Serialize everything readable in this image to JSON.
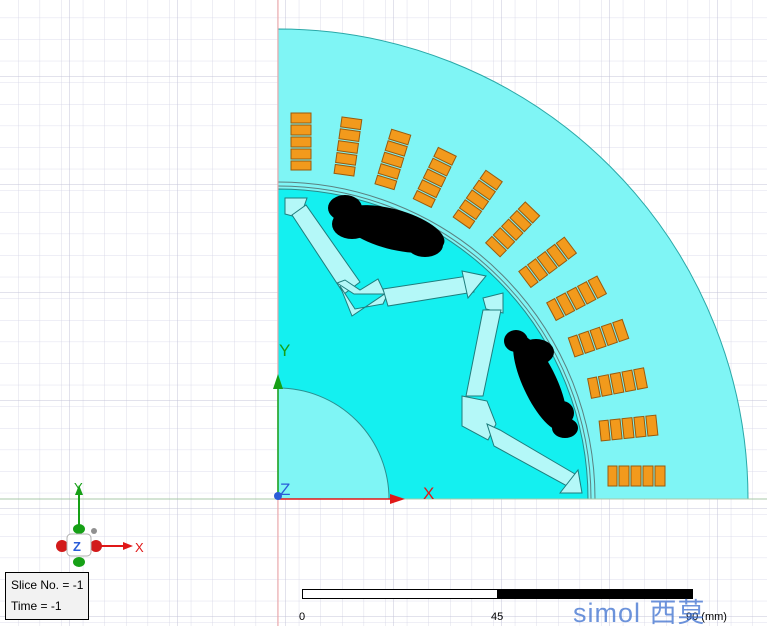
{
  "info": {
    "slice": "Slice No. = -1",
    "time": "Time = -1"
  },
  "axes": {
    "x_label": "X",
    "y_label": "Y",
    "z_label": "Z",
    "x_color": "#e01818",
    "y_color": "#16a016",
    "z_color": "#2a5cd8"
  },
  "triad": {
    "x_label": "X",
    "y_label": "Y",
    "z_label": "Z"
  },
  "scale": {
    "tick_0": "0",
    "tick_1": "45",
    "tick_2": "90 (mm)"
  },
  "watermark": "simol 西莫",
  "colors": {
    "stator": "#7ff5f5",
    "rotor": "#14f0f0",
    "winding": "#f29a1c",
    "grid": "#d4d4e6",
    "magnet_slot": "#b4f8f8",
    "background": "#ffffff"
  }
}
